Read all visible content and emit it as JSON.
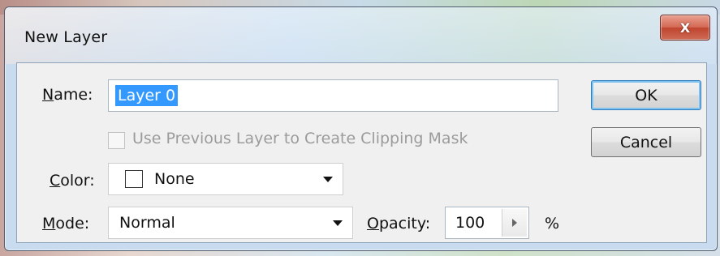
{
  "window": {
    "title": "New Layer",
    "close_label": "X"
  },
  "form": {
    "name_label_u": "N",
    "name_label_rest": "ame:",
    "name_value": "Layer 0",
    "clipping_label": "Use Previous Layer to Create Clipping Mask",
    "clipping_checked": false,
    "color_label_u": "C",
    "color_label_rest": "olor:",
    "color_value": "None",
    "mode_label_u": "M",
    "mode_label_rest": "ode:",
    "mode_value": "Normal",
    "opacity_label_u": "O",
    "opacity_label_rest": "pacity:",
    "opacity_value": "100",
    "percent_label": "%"
  },
  "buttons": {
    "ok_label": "OK",
    "cancel_label": "Cancel"
  }
}
